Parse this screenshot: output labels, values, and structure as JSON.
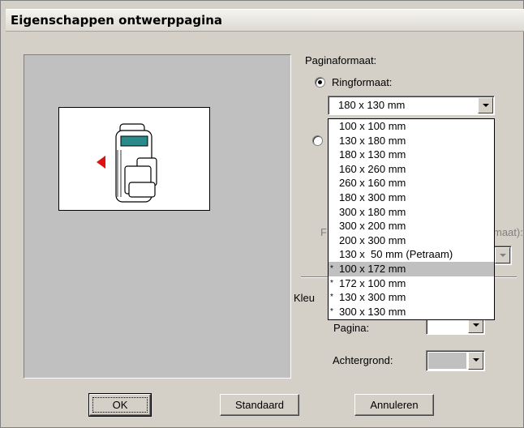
{
  "window": {
    "title": "Eigenschappen ontwerppagina"
  },
  "paginaformaat": {
    "group_label": "Paginaformaat:",
    "ringformaat_label": "Ringformaat:",
    "ringformaat_selected": true,
    "selected_value": "180 x 130 mm",
    "options": [
      {
        "mark": "",
        "label": "100 x 100 mm"
      },
      {
        "mark": "",
        "label": "130 x 180 mm"
      },
      {
        "mark": "",
        "label": "180 x 130 mm"
      },
      {
        "mark": "",
        "label": "160 x 260 mm"
      },
      {
        "mark": "",
        "label": "260 x 160 mm"
      },
      {
        "mark": "",
        "label": "180 x 300 mm"
      },
      {
        "mark": "",
        "label": "300 x 180 mm"
      },
      {
        "mark": "",
        "label": "300 x 200 mm"
      },
      {
        "mark": "",
        "label": "200 x 300 mm"
      },
      {
        "mark": "",
        "label": "130 x  50 mm (Petraam)"
      },
      {
        "mark": "*",
        "label": "100 x 172 mm"
      },
      {
        "mark": "*",
        "label": "172 x 100 mm"
      },
      {
        "mark": "*",
        "label": "130 x 300 mm"
      },
      {
        "mark": "*",
        "label": "300 x 130 mm"
      }
    ],
    "highlighted_index": 10,
    "partial_label_left": "F",
    "partial_label_right": "maat):"
  },
  "kleuren": {
    "group_label_partial": "Kleu",
    "pagina_label": "Pagina:",
    "achtergrond_label": "Achtergrond:",
    "achtergrond_color": "#c0c0c0",
    "pagina_color": "#ffffff"
  },
  "buttons": {
    "ok": "OK",
    "standaard": "Standaard",
    "annuleren": "Annuleren"
  },
  "colors": {
    "dialog_bg": "#d4d0c8",
    "preview_bg": "#c0c0c0",
    "arrow_red": "#e01010",
    "device_screen": "#2a8a8a"
  }
}
